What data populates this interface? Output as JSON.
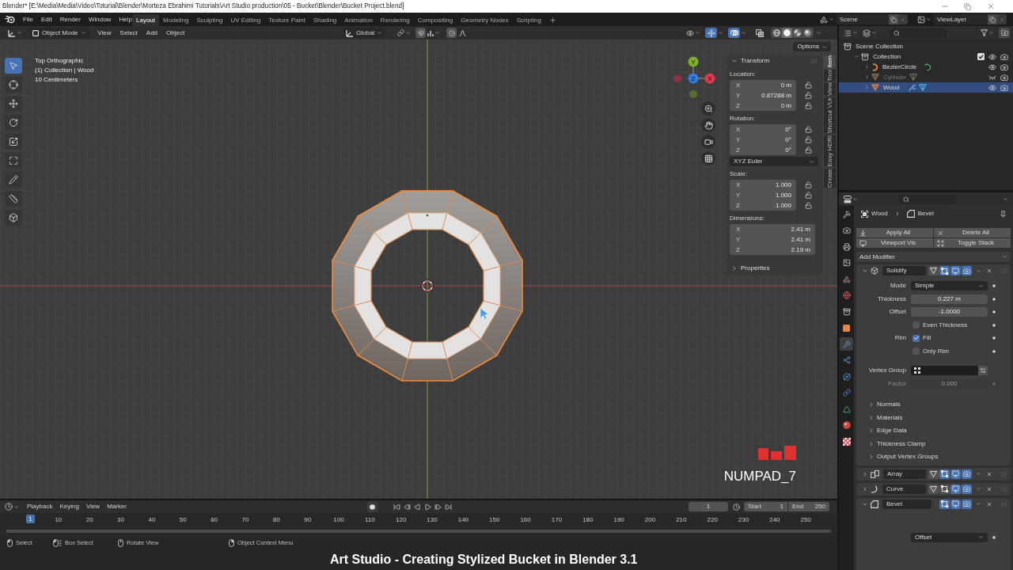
{
  "window": {
    "title": "Blender* [E:\\Media\\Media\\Video\\Toturial\\Blender\\Morteza Ebrahimi Tutorials\\Art Studio production\\05 - Bucket\\Blender\\Bucket Project.blend]"
  },
  "top_bar": {
    "menus": [
      "File",
      "Edit",
      "Render",
      "Window",
      "Help"
    ],
    "workspaces": [
      {
        "label": "Layout",
        "selected": true
      },
      {
        "label": "Modeling",
        "selected": false
      },
      {
        "label": "Sculpting",
        "selected": false
      },
      {
        "label": "UV Editing",
        "selected": false
      },
      {
        "label": "Texture Paint",
        "selected": false
      },
      {
        "label": "Shading",
        "selected": false
      },
      {
        "label": "Animation",
        "selected": false
      },
      {
        "label": "Rendering",
        "selected": false
      },
      {
        "label": "Compositing",
        "selected": false
      },
      {
        "label": "Geometry Nodes",
        "selected": false
      },
      {
        "label": "Scripting",
        "selected": false
      }
    ],
    "scene": "Scene",
    "view_layer": "ViewLayer"
  },
  "viewport_header": {
    "mode": "Object Mode",
    "menus": [
      "View",
      "Select",
      "Add",
      "Object"
    ],
    "orientation": "Global",
    "tool_settings": [
      {
        "kind": "snap",
        "on": false
      },
      {
        "kind": "proportional",
        "on": false
      }
    ],
    "toggles": [
      {
        "kind": "gizmos",
        "on": true
      },
      {
        "kind": "overlays",
        "on": true
      },
      {
        "kind": "xray",
        "on": false
      }
    ],
    "shading": [
      {
        "kind": "wireframe",
        "selected": false
      },
      {
        "kind": "solid",
        "selected": true
      },
      {
        "kind": "material",
        "selected": false
      },
      {
        "kind": "rendered",
        "selected": false
      }
    ]
  },
  "viewport": {
    "info": [
      "Top Orthographic",
      "(1) Collection | Wood",
      "10 Centimeters"
    ],
    "options": "Options",
    "tools": [
      {
        "kind": "select",
        "selected": true
      },
      {
        "kind": "cursor",
        "selected": false
      },
      {
        "kind": "move",
        "selected": false
      },
      {
        "kind": "rotate",
        "selected": false
      },
      {
        "kind": "scale",
        "selected": false
      },
      {
        "kind": "transform",
        "selected": false
      },
      {
        "kind": "annotate",
        "selected": false
      },
      {
        "kind": "measure",
        "selected": false
      },
      {
        "kind": "add-cube",
        "selected": false
      }
    ],
    "gizmo": {
      "x": "X",
      "y": "Y",
      "z": "Z"
    },
    "key_overlay": "NUMPAD_7"
  },
  "sidebar": {
    "tabs": [
      {
        "label": "Item",
        "selected": true
      },
      {
        "label": "Tool",
        "selected": false
      },
      {
        "label": "View",
        "selected": false
      },
      {
        "label": "Shortcut VUr",
        "selected": false
      },
      {
        "label": "Easy HDRI",
        "selected": false
      },
      {
        "label": "Create",
        "selected": false
      }
    ],
    "panels": [
      {
        "title": "Transform",
        "expanded": true,
        "groups": [
          {
            "label": "Location:",
            "locks": true,
            "fields": [
              {
                "axis": "X",
                "value": "0 m"
              },
              {
                "axis": "Y",
                "value": "0.87288 m"
              },
              {
                "axis": "Z",
                "value": "0 m"
              }
            ]
          },
          {
            "label": "Rotation:",
            "locks": true,
            "fields": [
              {
                "axis": "X",
                "value": "0°"
              },
              {
                "axis": "Y",
                "value": "0°"
              },
              {
                "axis": "Z",
                "value": "0°"
              }
            ],
            "mode": "XYZ Euler"
          },
          {
            "label": "Scale:",
            "locks": true,
            "fields": [
              {
                "axis": "X",
                "value": "1.000"
              },
              {
                "axis": "Y",
                "value": "1.000"
              },
              {
                "axis": "Z",
                "value": "1.000"
              }
            ]
          },
          {
            "label": "Dimensions:",
            "locks": false,
            "fields": [
              {
                "axis": "X",
                "value": "2.41 m"
              },
              {
                "axis": "Y",
                "value": "2.41 m"
              },
              {
                "axis": "Z",
                "value": "2.19 m"
              }
            ]
          }
        ]
      },
      {
        "title": "Properties",
        "expanded": false
      }
    ]
  },
  "outliner": {
    "tree": [
      {
        "name": "Scene Collection",
        "kind": "scene-collection",
        "selected": false,
        "children": [
          {
            "name": "Collection",
            "kind": "collection",
            "expanded": true,
            "selected": false,
            "checked": true,
            "visible": true,
            "children": [
              {
                "name": "BezierCircle",
                "kind": "curve",
                "expanded": false,
                "selected": false,
                "visible": true,
                "modifiers": false
              },
              {
                "name": "Cylinder",
                "kind": "mesh",
                "expanded": false,
                "selected": false,
                "visible": false,
                "modifiers": false
              },
              {
                "name": "Wood",
                "kind": "mesh",
                "expanded": false,
                "selected": true,
                "visible": true,
                "modifiers": true
              }
            ]
          }
        ]
      }
    ]
  },
  "properties": {
    "tabs": [
      {
        "kind": "tool",
        "selected": false
      },
      {
        "kind": "render",
        "selected": false
      },
      {
        "kind": "output",
        "selected": false
      },
      {
        "kind": "view-layer",
        "selected": false
      },
      {
        "kind": "scene",
        "selected": false
      },
      {
        "kind": "world",
        "selected": false
      },
      {
        "kind": "collection",
        "selected": false
      },
      {
        "kind": "object",
        "selected": false
      },
      {
        "kind": "modifiers",
        "selected": true
      },
      {
        "kind": "particles",
        "selected": false
      },
      {
        "kind": "physics",
        "selected": false
      },
      {
        "kind": "constraints",
        "selected": false
      },
      {
        "kind": "data",
        "selected": false
      },
      {
        "kind": "material",
        "selected": false
      },
      {
        "kind": "texture",
        "selected": false
      }
    ],
    "breadcrumb": {
      "object": "Wood",
      "modifier": "Bevel"
    },
    "actions": [
      {
        "kind": "apply",
        "label": "Apply All"
      },
      {
        "kind": "delete",
        "label": "Delete All"
      },
      {
        "kind": "viewport",
        "label": "Viewport Vis"
      },
      {
        "kind": "toggle",
        "label": "Toggle Stack"
      }
    ],
    "add_modifier": "Add Modifier",
    "modifiers": [
      {
        "kind": "solidify",
        "name": "Solidify",
        "expanded": true,
        "toggles": [
          {
            "kind": "cage",
            "on": false
          },
          {
            "kind": "edit",
            "on": true
          },
          {
            "kind": "viewport",
            "on": true
          },
          {
            "kind": "render",
            "on": true
          }
        ],
        "fields": [
          {
            "kind": "dropdown",
            "label": "Mode",
            "value": "Simple",
            "disabled": false
          },
          {
            "kind": "number",
            "label": "Thickness",
            "value": "0.227 m",
            "disabled": false
          },
          {
            "kind": "number",
            "label": "Offset",
            "value": "-1.0000",
            "disabled": false
          },
          {
            "kind": "checkbox",
            "text": "Even Thickness",
            "checked": false,
            "disabled": false
          },
          {
            "kind": "checkbox",
            "label": "Rim",
            "text": "Fill",
            "checked": true,
            "disabled": false
          },
          {
            "kind": "checkbox",
            "text": "Only Rim",
            "checked": false,
            "disabled": false
          },
          {
            "kind": "vertex-group",
            "label": "Vertex Group",
            "disabled": false
          },
          {
            "kind": "number",
            "label": "Factor",
            "value": "0.000",
            "disabled": true
          }
        ],
        "subpanels": [
          "Normals",
          "Materials",
          "Edge Data",
          "Thickness Clamp",
          "Output Vertex Groups"
        ]
      },
      {
        "kind": "array",
        "name": "Array",
        "expanded": false,
        "toggles": [
          {
            "kind": "cage",
            "on": false
          },
          {
            "kind": "edit",
            "on": true
          },
          {
            "kind": "viewport",
            "on": true
          },
          {
            "kind": "render",
            "on": true
          }
        ]
      },
      {
        "kind": "curve",
        "name": "Curve",
        "expanded": false,
        "toggles": [
          {
            "kind": "cage",
            "on": false
          },
          {
            "kind": "edit",
            "on": false
          },
          {
            "kind": "viewport",
            "on": true
          },
          {
            "kind": "render",
            "on": true
          }
        ]
      },
      {
        "kind": "bevel",
        "name": "Bevel",
        "expanded": true,
        "toggles": [
          {
            "kind": "edit",
            "on": true
          },
          {
            "kind": "viewport",
            "on": true
          },
          {
            "kind": "render",
            "on": true
          }
        ],
        "fields": [
          {
            "kind": "dropdown",
            "value": "Offset",
            "disabled": false
          }
        ]
      }
    ]
  },
  "timeline": {
    "menus": [
      "Playback",
      "Keying",
      "View",
      "Marker"
    ],
    "current_frame": "1",
    "start": {
      "label": "Start",
      "value": "1"
    },
    "end": {
      "label": "End",
      "value": "250"
    },
    "playhead": "1",
    "ruler": [
      "10",
      "20",
      "30",
      "40",
      "50",
      "60",
      "70",
      "80",
      "90",
      "100",
      "110",
      "120",
      "130",
      "140",
      "150",
      "160",
      "170",
      "180",
      "190",
      "200",
      "210",
      "220",
      "230",
      "240",
      "250"
    ]
  },
  "status_bar": [
    {
      "kind": "click",
      "label": "Select"
    },
    {
      "kind": "drag",
      "label": "Box Select"
    },
    {
      "kind": "middle",
      "label": "Rotate View"
    },
    {
      "kind": "right",
      "label": "Object Context Menu"
    }
  ],
  "caption": "Art Studio - Creating Stylized Bucket in Blender 3.1"
}
